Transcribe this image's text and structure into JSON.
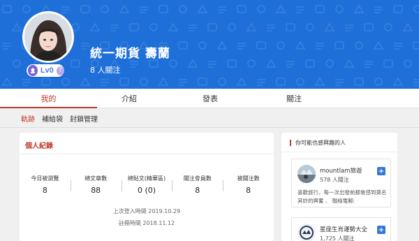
{
  "profile": {
    "name": "統一期貨 壽蘭",
    "follow_count": "8 人關注",
    "level": "Lv0",
    "level_help": "?"
  },
  "tabs": [
    {
      "label": "我的",
      "active": true
    },
    {
      "label": "介紹",
      "active": false
    },
    {
      "label": "發表",
      "active": false
    },
    {
      "label": "關注",
      "active": false
    }
  ],
  "subtabs": [
    {
      "label": "軌跡",
      "active": true
    },
    {
      "label": "補給袋",
      "active": false
    },
    {
      "label": "封鎖管理",
      "active": false
    }
  ],
  "record": {
    "title": "個人紀錄",
    "stats": [
      {
        "label": "今日被瀏覽",
        "value": "8"
      },
      {
        "label": "總文章數",
        "value": "88"
      },
      {
        "label": "總貼文(精華區)",
        "value": "0 (0)"
      },
      {
        "label": "關注會員數",
        "value": "8"
      },
      {
        "label": "被關注數",
        "value": "8"
      }
    ],
    "last_login": "上次登入時間 2019.10.29",
    "registered": "註冊時間 2018.11.12"
  },
  "sidebar": {
    "title": "你可能也感興趣的人",
    "users": [
      {
        "name": "mountlam旅遊",
        "followers": "578 人關注",
        "desc": "喜歡旅行，每一次出發前都會感到莫名其妙的興奮 、 聯絡電郵:"
      },
      {
        "name": "星座生肖運勢大全",
        "followers": "1,725 人關注",
        "desc": ""
      }
    ],
    "follow_button": "+"
  },
  "colors": {
    "banner": "#1e6fd8",
    "accent": "#c0392b",
    "follow_button": "#3478d6"
  }
}
